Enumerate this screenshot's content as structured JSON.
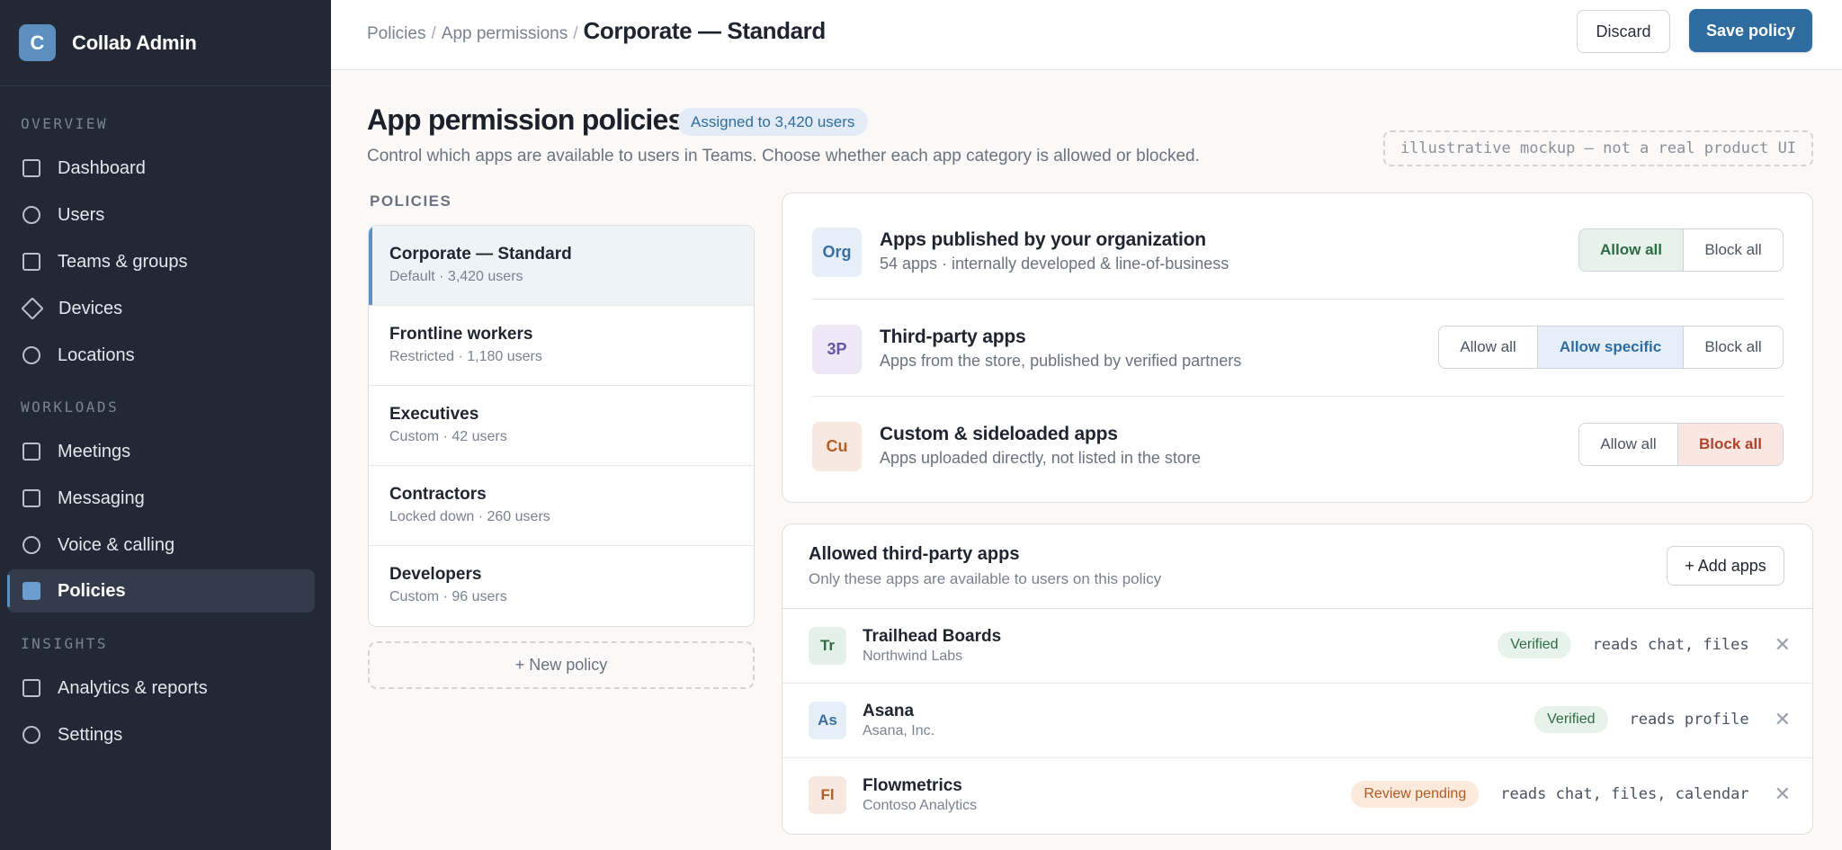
{
  "app": {
    "logo_letter": "C",
    "name": "Collab Admin"
  },
  "sidebar": {
    "sections": [
      {
        "label": "OVERVIEW"
      },
      {
        "label": "WORKLOADS"
      },
      {
        "label": "INSIGHTS"
      }
    ],
    "items": [
      {
        "label": "Dashboard",
        "icon": "square-icon"
      },
      {
        "label": "Users",
        "icon": "circle-icon"
      },
      {
        "label": "Teams & groups",
        "icon": "square-icon"
      },
      {
        "label": "Devices",
        "icon": "diamond-icon"
      },
      {
        "label": "Locations",
        "icon": "circle-icon"
      },
      {
        "label": "Meetings",
        "icon": "square-icon"
      },
      {
        "label": "Messaging",
        "icon": "square-icon"
      },
      {
        "label": "Voice & calling",
        "icon": "circle-icon"
      },
      {
        "label": "Policies",
        "icon": "square-icon",
        "active": true
      },
      {
        "label": "Analytics & reports",
        "icon": "square-icon"
      },
      {
        "label": "Settings",
        "icon": "circle-icon"
      }
    ]
  },
  "header": {
    "breadcrumb": [
      "Policies",
      "App permissions"
    ],
    "separator": "/",
    "current": "Corporate — Standard",
    "discard_label": "Discard",
    "save_label": "Save policy"
  },
  "main": {
    "title": "App permission policies",
    "assigned_badge": "Assigned to 3,420 users",
    "subtitle": "Control which apps are available to users in Teams. Choose whether each app category is allowed or blocked.",
    "mockup_note": "illustrative mockup — not a real product UI",
    "policies_label": "POLICIES",
    "policies": [
      {
        "name": "Corporate — Standard",
        "meta": "Default · 3,420 users",
        "active": true
      },
      {
        "name": "Frontline workers",
        "meta": "Restricted · 1,180 users"
      },
      {
        "name": "Executives",
        "meta": "Custom · 42 users"
      },
      {
        "name": "Contractors",
        "meta": "Locked down · 260 users"
      },
      {
        "name": "Developers",
        "meta": "Custom · 96 users"
      }
    ],
    "new_policy_label": "+ New policy",
    "categories": [
      {
        "icon_text": "Org",
        "title": "Apps published by your organization",
        "description": "54 apps · internally developed & line-of-business",
        "options": [
          "Allow all",
          "Block all"
        ],
        "selected": "Allow all"
      },
      {
        "icon_text": "3P",
        "title": "Third-party apps",
        "description": "Apps from the store, published by verified partners",
        "options": [
          "Allow all",
          "Allow specific",
          "Block all"
        ],
        "selected": "Allow specific"
      },
      {
        "icon_text": "Cu",
        "title": "Custom & sideloaded apps",
        "description": "Apps uploaded directly, not listed in the store",
        "options": [
          "Allow all",
          "Block all"
        ],
        "selected": "Block all"
      }
    ],
    "allowed_apps": {
      "title": "Allowed third-party apps",
      "subtitle": "Only these apps are available to users on this policy",
      "add_label": "+ Add apps",
      "remove_glyph": "✕",
      "apps": [
        {
          "initials": "Tr",
          "name": "Trailhead Boards",
          "vendor": "Northwind Labs",
          "status": "Verified",
          "permissions": "reads chat, files"
        },
        {
          "initials": "As",
          "name": "Asana",
          "vendor": "Asana, Inc.",
          "status": "Verified",
          "permissions": "reads profile"
        },
        {
          "initials": "Fl",
          "name": "Flowmetrics",
          "vendor": "Contoso Analytics",
          "status": "Review pending",
          "permissions": "reads chat, files, calendar"
        }
      ]
    }
  },
  "colors": {
    "sidebar_bg": "#222834",
    "accent": "#2f6da0",
    "allow": "#2e6b45",
    "block": "#b4432d",
    "pending": "#b05a22"
  }
}
